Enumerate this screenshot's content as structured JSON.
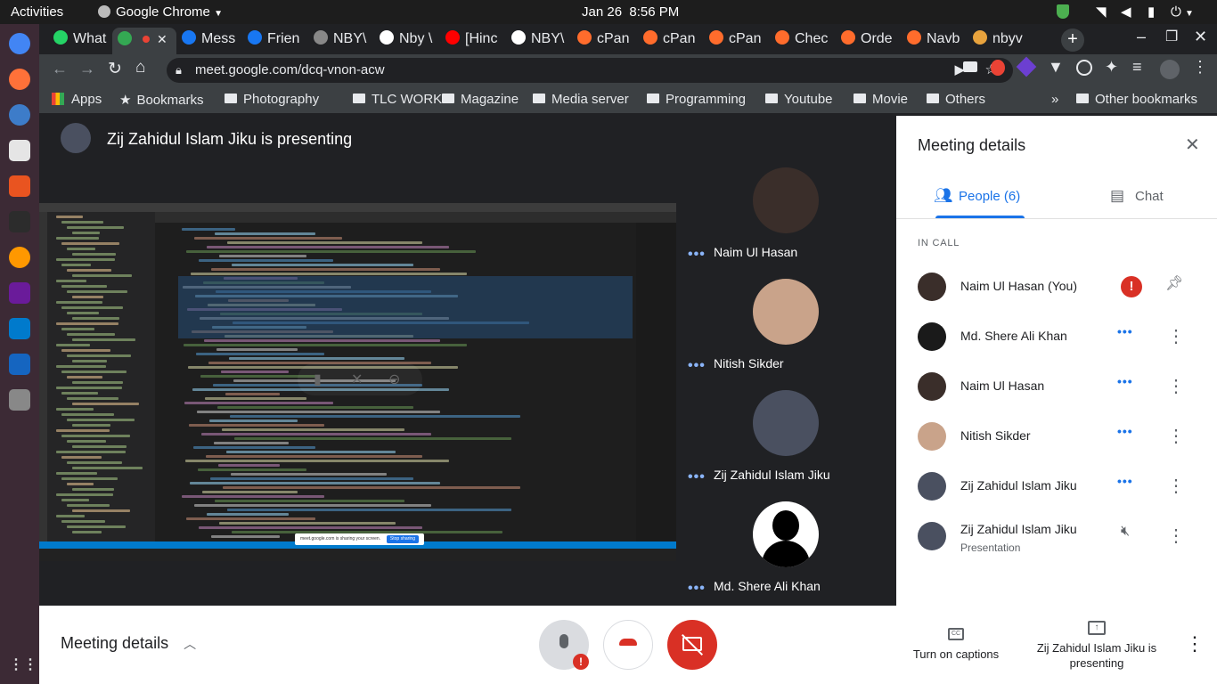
{
  "system_bar": {
    "activities": "Activities",
    "app_name": "Google Chrome",
    "date": "Jan 26",
    "time": "8:56 PM"
  },
  "tabs": [
    {
      "label": "What",
      "color": "#25d366"
    },
    {
      "label": "",
      "color": "#34a853"
    },
    {
      "label": "Mess",
      "color": "#1877f2"
    },
    {
      "label": "Frien",
      "color": "#1877f2"
    },
    {
      "label": "NBY\\",
      "color": "#888888"
    },
    {
      "label": "Nby \\",
      "color": "#ffffff"
    },
    {
      "label": "[Hinc",
      "color": "#ff0000"
    },
    {
      "label": "NBY\\",
      "color": "#ffffff"
    },
    {
      "label": "cPan",
      "color": "#ff6c2c"
    },
    {
      "label": "cPan",
      "color": "#ff6c2c"
    },
    {
      "label": "cPan",
      "color": "#ff6c2c"
    },
    {
      "label": "Chec",
      "color": "#ff6c2c"
    },
    {
      "label": "Orde",
      "color": "#ff6c2c"
    },
    {
      "label": "Navb",
      "color": "#ff6c2c"
    },
    {
      "label": "nbyv",
      "color": "#e8a33d"
    }
  ],
  "address": {
    "url": "meet.google.com/dcq-vnon-acw"
  },
  "bookmarks": {
    "apps": "Apps",
    "bookmarks": "Bookmarks",
    "folders": [
      "Photography",
      "TLC WORK",
      "Magazine",
      "Media server",
      "Programming",
      "Youtube",
      "Movie",
      "Others"
    ],
    "overflow": "»",
    "other": "Other bookmarks"
  },
  "presentation": {
    "banner": "Zij Zahidul Islam Jiku is presenting",
    "share_notice": "meet.google.com is sharing your screen.",
    "stop_sharing": "Stop sharing"
  },
  "tiles": [
    {
      "name": "Naim Ul Hasan",
      "color": "#3a2e2a"
    },
    {
      "name": "Nitish Sikder",
      "color": "#c9a38a"
    },
    {
      "name": "Zij Zahidul Islam Jiku",
      "color": "#4a5060"
    },
    {
      "name": "Md. Shere Ali Khan",
      "color": "#ffffff"
    }
  ],
  "panel": {
    "title": "Meeting details",
    "tab_people": "People (6)",
    "tab_chat": "Chat",
    "section": "IN CALL",
    "participants": [
      {
        "name": "Naim Ul Hasan (You)",
        "sub": "",
        "color": "#3a2e2a"
      },
      {
        "name": "Md. Shere Ali Khan",
        "sub": "",
        "color": "#1a1a1a"
      },
      {
        "name": "Naim Ul Hasan",
        "sub": "",
        "color": "#3a2e2a"
      },
      {
        "name": "Nitish Sikder",
        "sub": "",
        "color": "#c9a38a"
      },
      {
        "name": "Zij Zahidul Islam Jiku",
        "sub": "",
        "color": "#4a5060"
      },
      {
        "name": "Zij Zahidul Islam Jiku",
        "sub": "Presentation",
        "color": "#4a5060"
      }
    ]
  },
  "bottom": {
    "meeting_details": "Meeting details",
    "captions": "Turn on captions",
    "presenting": "Zij Zahidul Islam Jiku is presenting"
  },
  "colors": {
    "accent": "#1a73e8",
    "end_call": "#ea4335",
    "teal": "#00897b"
  }
}
